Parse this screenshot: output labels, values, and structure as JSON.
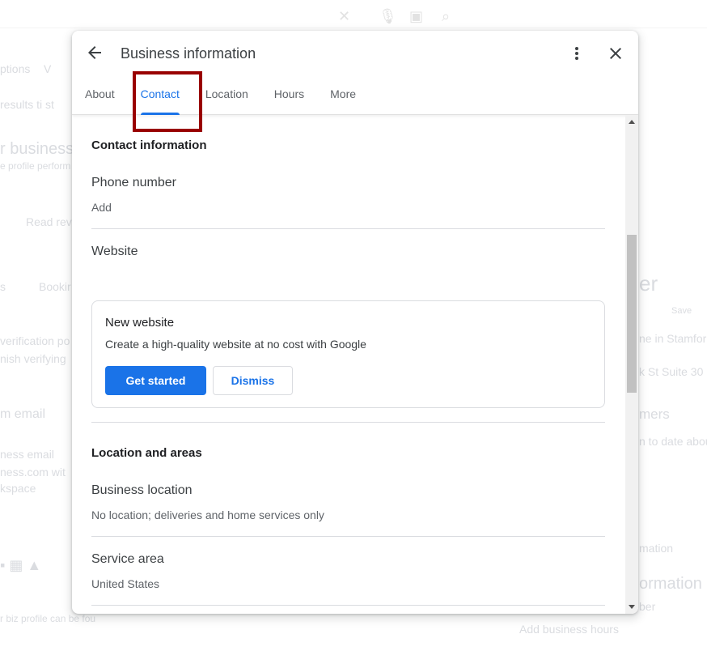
{
  "background": {
    "fragments": [
      "ptions",
      "V",
      "results ti st",
      "r business",
      "e profile perform",
      "Read rev",
      "s",
      "Bookir",
      "verification po",
      "nish verifying",
      "m email",
      "ness email",
      "ness.com wit",
      "kspace",
      "r biz profile can be fou",
      "r",
      "er",
      "Save",
      "ne in Stamfor",
      "k St Suite 30",
      "mers",
      "n to date abou",
      "mation",
      "ormation",
      "ber",
      "Add business hours"
    ]
  },
  "dialog": {
    "title": "Business information",
    "tabs": [
      {
        "label": "About",
        "active": false
      },
      {
        "label": "Contact",
        "active": true
      },
      {
        "label": "Location",
        "active": false
      },
      {
        "label": "Hours",
        "active": false
      },
      {
        "label": "More",
        "active": false
      }
    ],
    "sections": {
      "contact": {
        "title": "Contact information",
        "phone": {
          "label": "Phone number",
          "value": "Add"
        },
        "website": {
          "label": "Website"
        },
        "card": {
          "title": "New website",
          "description": "Create a high-quality website at no cost with Google",
          "primary_button": "Get started",
          "secondary_button": "Dismiss"
        }
      },
      "location": {
        "title": "Location and areas",
        "business_location": {
          "label": "Business location",
          "value": "No location; deliveries and home services only"
        },
        "service_area": {
          "label": "Service area",
          "value": "United States"
        }
      }
    }
  },
  "colors": {
    "accent": "#1a73e8",
    "highlight_box": "#990000"
  }
}
